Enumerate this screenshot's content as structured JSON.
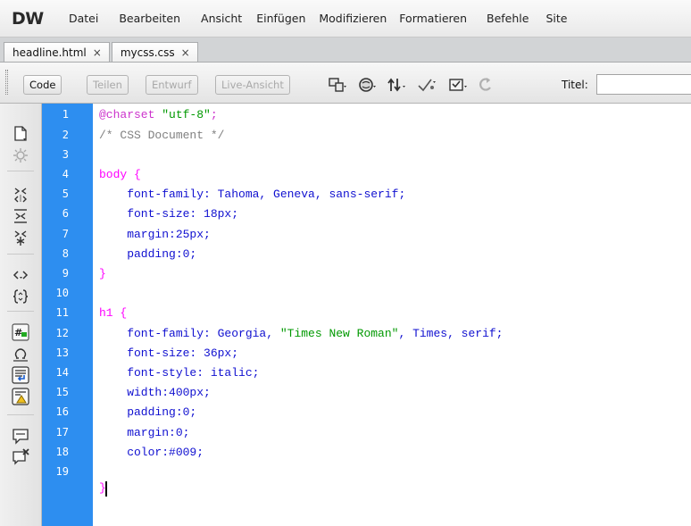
{
  "app": {
    "logo": "DW"
  },
  "menu": [
    "Datei",
    "Bearbeiten",
    "Ansicht",
    "Einfügen",
    "Modifizieren",
    "Formatieren",
    "Befehle",
    "Site"
  ],
  "tabs": [
    {
      "label": "headline.html",
      "close": "×"
    },
    {
      "label": "mycss.css",
      "close": "×"
    }
  ],
  "toolbar": {
    "views": [
      "Code",
      "Teilen",
      "Entwurf",
      "Live-Ansicht"
    ],
    "active_view": "Code",
    "title_label": "Titel:",
    "title_value": "",
    "icons": [
      "multiscreen-icon",
      "browser-preview-icon",
      "file-management-icon",
      "validate-icon",
      "check-browser-icon",
      "refresh-icon"
    ]
  },
  "sidebar": {
    "icons": [
      "open-documents-icon",
      "highlight-invalid-icon",
      "collapse-full-tag-icon",
      "collapse-selection-icon",
      "expand-all-icon",
      "select-parent-tag-icon",
      "balance-braces-icon",
      "line-numbers-icon",
      "syntax-coloring-icon",
      "word-wrap-icon",
      "info-bar-icon",
      "apply-comment-icon",
      "remove-comment-icon"
    ]
  },
  "editor": {
    "line_numbers": [
      "1",
      "2",
      "3",
      "4",
      "5",
      "6",
      "7",
      "8",
      "9",
      "10",
      "11",
      "12",
      "13",
      "14",
      "15",
      "16",
      "17",
      "18",
      "19"
    ],
    "lines": [
      {
        "p1": "@charset ",
        "p2": "\"utf-8\"",
        "p3": ";"
      },
      {
        "text": "/* CSS Document */"
      },
      {
        "text": ""
      },
      {
        "sel": "body {"
      },
      {
        "prop": "    font-family: Tahoma, Geneva, sans-serif;"
      },
      {
        "prop": "    font-size: 18px;"
      },
      {
        "prop": "    margin:25px;"
      },
      {
        "prop": "    padding:0;"
      },
      {
        "sel": "}"
      },
      {
        "text": ""
      },
      {
        "sel": "h1 {"
      },
      {
        "p1": "    font-family: Georgia, ",
        "p2": "\"Times New Roman\"",
        "p3": ", Times, serif;"
      },
      {
        "prop": "    font-size: 36px;"
      },
      {
        "prop": "    font-style: italic;"
      },
      {
        "prop": "    width:400px;"
      },
      {
        "prop": "    padding:0;"
      },
      {
        "prop": "    margin:0;"
      },
      {
        "prop": "    color:#009;"
      },
      {
        "sel": "}"
      }
    ]
  },
  "colors": {
    "gutter": "#2d8ef0",
    "selector": "#ff00ff",
    "property": "#1010d0",
    "string": "#009900",
    "comment": "#808080",
    "at_rule": "#cc33cc"
  }
}
